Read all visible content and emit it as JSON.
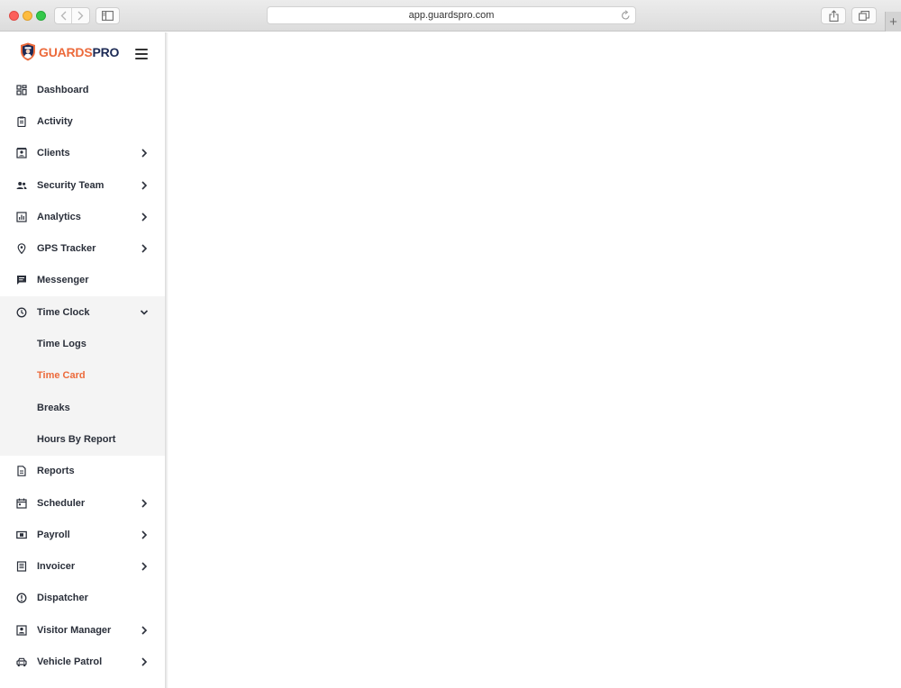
{
  "browser": {
    "url": "app.guardspro.com",
    "new_tab_symbol": "+",
    "icons": [
      "back-icon",
      "forward-icon",
      "sidebar-icon",
      "reload-icon",
      "share-icon",
      "tabs-icon"
    ]
  },
  "brand": {
    "name_part1": "GUARDS",
    "name_part2": "PRO",
    "accent_color": "#ec6a3b",
    "dark_color": "#1c2a55"
  },
  "sidebar": {
    "items": [
      {
        "label": "Dashboard",
        "icon": "dashboard-icon",
        "has_children": false
      },
      {
        "label": "Activity",
        "icon": "clipboard-icon",
        "has_children": false
      },
      {
        "label": "Clients",
        "icon": "client-card-icon",
        "has_children": true
      },
      {
        "label": "Security Team",
        "icon": "people-icon",
        "has_children": true
      },
      {
        "label": "Analytics",
        "icon": "analytics-icon",
        "has_children": true
      },
      {
        "label": "GPS Tracker",
        "icon": "location-pin-icon",
        "has_children": true
      },
      {
        "label": "Messenger",
        "icon": "message-icon",
        "has_children": false
      },
      {
        "label": "Time Clock",
        "icon": "clock-icon",
        "has_children": true,
        "expanded": true
      },
      {
        "label": "Reports",
        "icon": "report-icon",
        "has_children": false
      },
      {
        "label": "Scheduler",
        "icon": "calendar-icon",
        "has_children": true
      },
      {
        "label": "Payroll",
        "icon": "payroll-icon",
        "has_children": true
      },
      {
        "label": "Invoicer",
        "icon": "invoice-icon",
        "has_children": true
      },
      {
        "label": "Dispatcher",
        "icon": "dispatcher-icon",
        "has_children": false
      },
      {
        "label": "Visitor Manager",
        "icon": "visitor-icon",
        "has_children": true
      },
      {
        "label": "Vehicle Patrol",
        "icon": "car-icon",
        "has_children": true
      }
    ],
    "time_clock_children": [
      {
        "label": "Time Logs",
        "active": false
      },
      {
        "label": "Time Card",
        "active": true
      },
      {
        "label": "Breaks",
        "active": false
      },
      {
        "label": "Hours By Report",
        "active": false
      }
    ]
  }
}
